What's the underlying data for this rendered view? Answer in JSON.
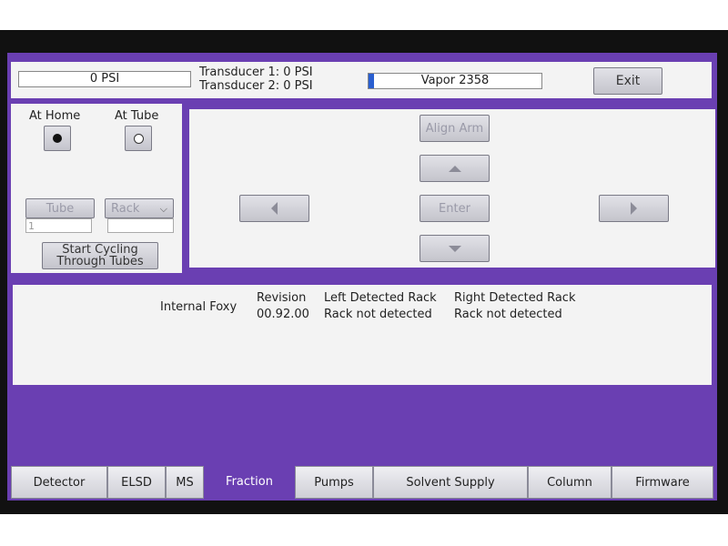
{
  "status": {
    "psi": "0 PSI",
    "transducer1": "Transducer 1: 0 PSI",
    "transducer2": "Transducer 2: 0 PSI",
    "vapor_label": "Vapor 2358",
    "vapor_fill_fraction": 0.03,
    "exit_label": "Exit"
  },
  "left_panel": {
    "at_home_label": "At Home",
    "at_tube_label": "At Tube",
    "at_home_selected": true,
    "tube_label": "Tube",
    "tube_value": "1",
    "rack_label": "Rack",
    "rack_value": "",
    "start_cycling_line1": "Start Cycling",
    "start_cycling_line2": "Through Tubes"
  },
  "center_panel": {
    "align_arm_label": "Align Arm",
    "enter_label": "Enter"
  },
  "info": {
    "device_name": "Internal Foxy",
    "revision_header": "Revision",
    "revision_value": "00.92.00",
    "left_rack_header": "Left Detected Rack",
    "left_rack_value": "Rack not detected",
    "right_rack_header": "Right Detected Rack",
    "right_rack_value": "Rack not detected"
  },
  "tabs": [
    {
      "label": "Detector"
    },
    {
      "label": "ELSD"
    },
    {
      "label": "MS"
    },
    {
      "label": "Fraction"
    },
    {
      "label": "Pumps"
    },
    {
      "label": "Solvent Supply"
    },
    {
      "label": "Column"
    },
    {
      "label": "Firmware"
    }
  ],
  "active_tab": "Fraction",
  "colors": {
    "screen_background": "#6a3fb2",
    "panel_background": "#f3f3f3",
    "vapor_fill": "#2a5fd0"
  }
}
